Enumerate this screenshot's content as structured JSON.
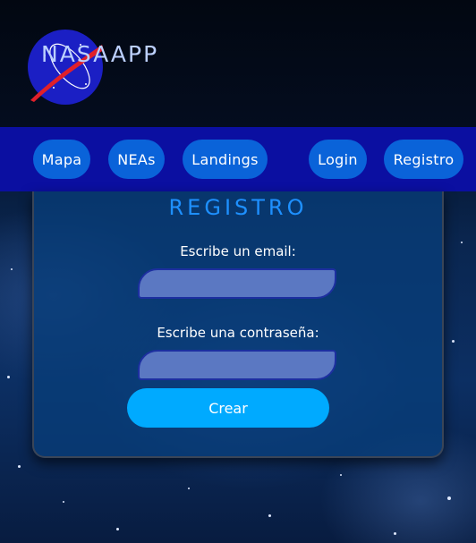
{
  "brand": {
    "name": "NASAAPP"
  },
  "nav": {
    "items": [
      {
        "label": "Mapa"
      },
      {
        "label": "NEAs"
      },
      {
        "label": "Landings"
      },
      {
        "label": "Login"
      },
      {
        "label": "Registro"
      }
    ]
  },
  "form": {
    "title": "REGISTRO",
    "email_label": "Escribe un email:",
    "email_value": "",
    "password_label": "Escribe una contraseña:",
    "password_value": "",
    "submit_label": "Crear"
  },
  "colors": {
    "navbar": "#0b0fa1",
    "nav_button": "#0a63d9",
    "title": "#1e90ff",
    "submit": "#00aaff",
    "input_fill": "#5b78c2"
  }
}
